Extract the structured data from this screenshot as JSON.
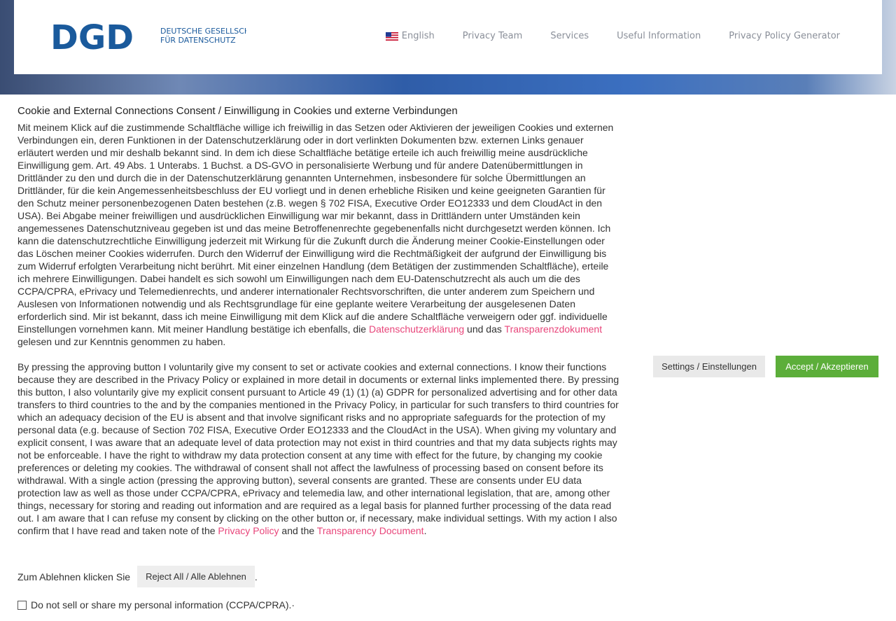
{
  "header": {
    "logo": {
      "letters": "DGD",
      "line1": "DEUTSCHE GESELLSCHAFT",
      "line2": "FÜR DATENSCHUTZ"
    },
    "nav": [
      {
        "label": "English",
        "icon": "us-flag-icon"
      },
      {
        "label": "Privacy Team"
      },
      {
        "label": "Services"
      },
      {
        "label": "Useful Information"
      },
      {
        "label": "Privacy Policy Generator"
      }
    ]
  },
  "consent": {
    "title": "Cookie and External Connections Consent / Einwilligung in Cookies und externe Verbindungen",
    "german_text": "Mit meinem Klick auf die zustimmende Schaltfläche willige ich freiwillig in das Setzen oder Aktivieren der jeweiligen Cookies und externen Verbindungen ein, deren Funktionen in der Datenschutzerklärung oder in dort verlinkten Dokumenten bzw. externen Links genauer erläutert werden und mir deshalb bekannt sind. In dem ich diese Schaltfläche betätige erteile ich auch freiwillig meine ausdrückliche Einwilligung gem. Art. 49 Abs. 1 Unterabs. 1 Buchst. a DS-GVO in personalisierte Werbung und für andere Datenübermittlungen in Drittländer zu den und durch die in der Datenschutzerklärung genannten Unternehmen, insbesondere für solche Übermittlungen an Drittländer, für die kein Angemessenheitsbeschluss der EU vorliegt und in denen erhebliche Risiken und keine geeigneten Garantien für den Schutz meiner personenbezogenen Daten bestehen (z.B. wegen § 702 FISA, Executive Order EO12333 und dem CloudAct in den USA). Bei Abgabe meiner freiwilligen und ausdrücklichen Einwilligung war mir bekannt, dass in Drittländern unter Umständen kein angemessenes Datenschutzniveau gegeben ist und das meine Betroffenenrechte gegebenenfalls nicht durchgesetzt werden können. Ich kann die datenschutzrechtliche Einwilligung jederzeit mit Wirkung für die Zukunft durch die Änderung meiner Cookie-Einstellungen oder das Löschen meiner Cookies widerrufen. Durch den Widerruf der Einwilligung wird die Rechtmäßigkeit der aufgrund der Einwilligung bis zum Widerruf erfolgten Verarbeitung nicht berührt. Mit einer einzelnen Handlung (dem Betätigen der zustimmenden Schaltfläche), erteile ich mehrere Einwilligungen. Dabei handelt es sich sowohl um Einwilligungen nach dem EU-Datenschutzrecht als auch um die des CCPA/CPRA, ePrivacy und Telemedienrechts, und anderer internationaler Rechtsvorschriften, die unter anderem zum Speichern und Auslesen von Informationen notwendig und als Rechtsgrundlage für eine geplante weitere Verarbeitung der ausgelesenen Daten erforderlich sind. Mir ist bekannt, dass ich meine Einwilligung mit dem Klick auf die andere Schaltfläche verweigern oder ggf. individuelle Einstellungen vornehmen kann. Mit meiner Handlung bestätige ich ebenfalls, die ",
    "german_link1": "Datenschutzerklärung",
    "german_mid": " und das ",
    "german_link2": "Transparenzdokument",
    "german_end": " gelesen und zur Kenntnis genommen zu haben.",
    "english_text": "By pressing the approving button I voluntarily give my consent to set or activate cookies and external connections. I know their functions because they are described in the Privacy Policy or explained in more detail in documents or external links implemented there. By pressing this button, I also voluntarily give my explicit consent pursuant to Article 49 (1) (1) (a) GDPR for personalized advertising and for other data transfers to third countries to the and by the companies mentioned in the Privacy Policy, in particular for such transfers to third countries for which an adequacy decision of the EU is absent and that involve significant risks and no appropriate safeguards for the protection of my personal data (e.g. because of Section 702 FISA, Executive Order EO12333 and the CloudAct in the USA). When giving my voluntary and explicit consent, I was aware that an adequate level of data protection may not exist in third countries and that my data subjects rights may not be enforceable. I have the right to withdraw my data protection consent at any time with effect for the future, by changing my cookie preferences or deleting my cookies. The withdrawal of consent shall not affect the lawfulness of processing based on consent before its withdrawal. With a single action (pressing the approving button), several consents are granted. These are consents under EU data protection law as well as those under CCPA/CPRA, ePrivacy and telemedia law, and other international legislation, that are, among other things, necessary for storing and reading out information and are required as a legal basis for planned further processing of the data read out. I am aware that I can refuse my consent by clicking on the other button or, if necessary, make individual settings. With my action I also confirm that I have read and taken note of the ",
    "english_link1": "Privacy Policy",
    "english_mid": " and the ",
    "english_link2": "Transparency Document",
    "english_end": ".",
    "reject_prefix": "Zum Ablehnen klicken Sie",
    "reject_button": "Reject All / Alle Ablehnen",
    "reject_suffix": ".",
    "optout_label": "Do not sell or share my personal information (CCPA/CPRA).·",
    "settings_button": "Settings / Einstellungen",
    "accept_button": "Accept / Akzeptieren"
  },
  "colors": {
    "link": "#e8457a",
    "accept": "#5cae3a",
    "logo_blue": "#1a5a9c"
  }
}
